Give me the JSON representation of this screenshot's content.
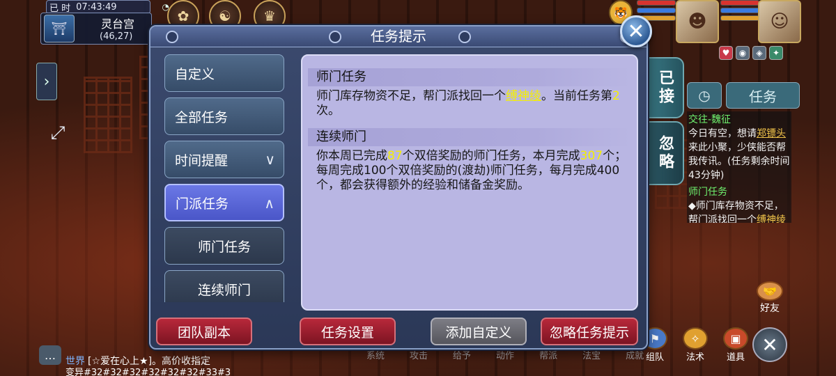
{
  "hud": {
    "clock_label": "已 时",
    "time": "07:43:49",
    "map_name": "灵台宫",
    "coords": "(46,27)"
  },
  "dialog": {
    "title": "任务提示",
    "close_glyph": "✕"
  },
  "categories": [
    {
      "label": "自定义"
    },
    {
      "label": "全部任务"
    },
    {
      "label": "时间提醒",
      "chevron": "∨"
    },
    {
      "label": "门派任务",
      "chevron": "∧",
      "active": true
    },
    {
      "label": "师门任务",
      "sub": true
    },
    {
      "label": "连续师门",
      "sub": true
    }
  ],
  "content": {
    "section1": {
      "title": "师门任务",
      "text_a": "师门库存物资不足，帮门派找回一个",
      "item": "缚神绫",
      "text_b": "。当前任务第",
      "count": "2",
      "text_c": "次。"
    },
    "section2": {
      "title": "连续师门",
      "text_a": "你本周已完成",
      "week_count": "87",
      "text_b": "个双倍奖励的师门任务，本月完成",
      "month_count": "307",
      "text_c": "个；每周完成100个双倍奖励的(渡劫)师门任务，每月完成400个，都会获得额外的经验和储备金奖励。"
    }
  },
  "buttons": {
    "team_dungeon": "团队副本",
    "task_settings": "任务设置",
    "add_custom": "添加自定义",
    "ignore_tips": "忽略任务提示"
  },
  "side_tabs": {
    "accepted": "已接",
    "ignore": "忽略"
  },
  "quest_panel": {
    "task_label": "任务",
    "entries": [
      {
        "title": "交往-魏征",
        "text_a": "今日有空，想请",
        "link": "郑镖头",
        "text_b": "来此小聚，少侠能否帮我传讯。(任务剩余时间43分钟)"
      },
      {
        "title": "师门任务",
        "text_a": "◆师门库存物资不足，帮门派找回一个",
        "link": "缚神绫",
        "text_b": ""
      }
    ]
  },
  "chat": {
    "channel": "世界",
    "line1": "[☆爱在心上★]。高价收指定",
    "line2": "变异#32#32#32#32#32#32#33#3"
  },
  "bottom_menu": {
    "labels": [
      "系统",
      "攻击",
      "给予",
      "动作",
      "帮派",
      "法宝",
      "成就"
    ],
    "icons": [
      {
        "label": "组队",
        "icon": "team-icon"
      },
      {
        "label": "法术",
        "icon": "spell-icon"
      },
      {
        "label": "道具",
        "icon": "items-icon"
      }
    ],
    "friends": "好友",
    "close_glyph": "✕"
  },
  "colors": {
    "highlight": "#f5f000",
    "active_tab": "#5a66d8",
    "action_red": "#9c1e2e",
    "quest_title_green": "#6ff26f"
  }
}
